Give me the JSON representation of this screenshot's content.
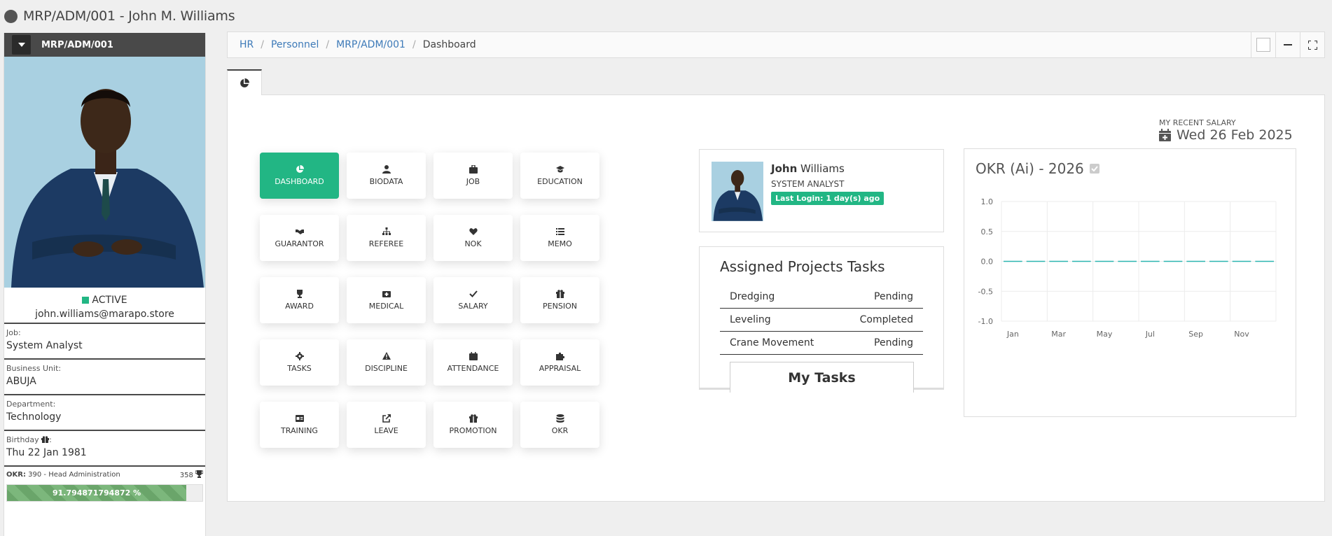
{
  "title": "MRP/ADM/001 - John M. Williams",
  "left_panel": {
    "code": "MRP/ADM/001",
    "status": "ACTIVE",
    "email": "john.williams@marapo.store",
    "fields": [
      {
        "label": "Job:",
        "value": "System Analyst"
      },
      {
        "label": "Business Unit:",
        "value": "ABUJA"
      },
      {
        "label": "Department:",
        "value": "Technology"
      },
      {
        "label": "Birthday",
        "label_suffix": ":",
        "value": "Thu 22 Jan 1981"
      }
    ],
    "okr": {
      "label": "OKR:",
      "text": "390 - Head Administration",
      "points": "358",
      "percent_text": "91.794871794872 %",
      "progress": 0.918
    }
  },
  "breadcrumb": {
    "items": [
      "HR",
      "Personnel",
      "MRP/ADM/001"
    ],
    "current": "Dashboard"
  },
  "tiles": [
    {
      "label": "DASHBOARD",
      "icon": "pie-chart-icon"
    },
    {
      "label": "BIODATA",
      "icon": "user-icon"
    },
    {
      "label": "JOB",
      "icon": "briefcase-icon"
    },
    {
      "label": "EDUCATION",
      "icon": "graduation-cap-icon"
    },
    {
      "label": "GUARANTOR",
      "icon": "handshake-icon"
    },
    {
      "label": "REFEREE",
      "icon": "sitemap-icon"
    },
    {
      "label": "NOK",
      "icon": "heart-icon"
    },
    {
      "label": "MEMO",
      "icon": "list-icon"
    },
    {
      "label": "AWARD",
      "icon": "trophy-icon"
    },
    {
      "label": "MEDICAL",
      "icon": "medkit-icon"
    },
    {
      "label": "SALARY",
      "icon": "check-icon"
    },
    {
      "label": "PENSION",
      "icon": "gift-icon"
    },
    {
      "label": "TASKS",
      "icon": "cog-icon"
    },
    {
      "label": "DISCIPLINE",
      "icon": "warning-icon"
    },
    {
      "label": "ATTENDANCE",
      "icon": "calendar-icon"
    },
    {
      "label": "APPRAISAL",
      "icon": "puzzle-icon"
    },
    {
      "label": "TRAINING",
      "icon": "id-card-icon"
    },
    {
      "label": "LEAVE",
      "icon": "external-link-icon"
    },
    {
      "label": "PROMOTION",
      "icon": "gift-icon"
    },
    {
      "label": "OKR",
      "icon": "database-icon"
    }
  ],
  "salary": {
    "label": "MY RECENT SALARY",
    "date": "Wed 26 Feb 2025"
  },
  "profile": {
    "first_name": "John",
    "last_name": "Williams",
    "role": "SYSTEM ANALYST",
    "last_login": "Last Login: 1 day(s) ago"
  },
  "tasks": {
    "title": "Assigned Projects Tasks",
    "rows": [
      {
        "name": "Dredging",
        "status": "Pending"
      },
      {
        "name": "Leveling",
        "status": "Completed"
      },
      {
        "name": "Crane Movement",
        "status": "Pending"
      }
    ],
    "button": "My Tasks"
  },
  "chart_data": {
    "type": "line",
    "title": "OKR (Ai) - 2026",
    "x": [
      "Jan",
      "Feb",
      "Mar",
      "Apr",
      "May",
      "Jun",
      "Jul",
      "Aug",
      "Sep",
      "Oct",
      "Nov",
      "Dec"
    ],
    "tick_labels_x": [
      "Jan",
      "Mar",
      "May",
      "Jul",
      "Sep",
      "Nov"
    ],
    "series": [
      {
        "values": [
          0,
          0,
          0,
          0,
          0,
          0,
          0,
          0,
          0,
          0,
          0,
          0
        ]
      }
    ],
    "yticks": [
      "1.0",
      "0.5",
      "0.0",
      "-0.5",
      "-1.0"
    ],
    "ylim": [
      -1,
      1
    ],
    "grid": true,
    "line_color": "#2bb5b0"
  }
}
